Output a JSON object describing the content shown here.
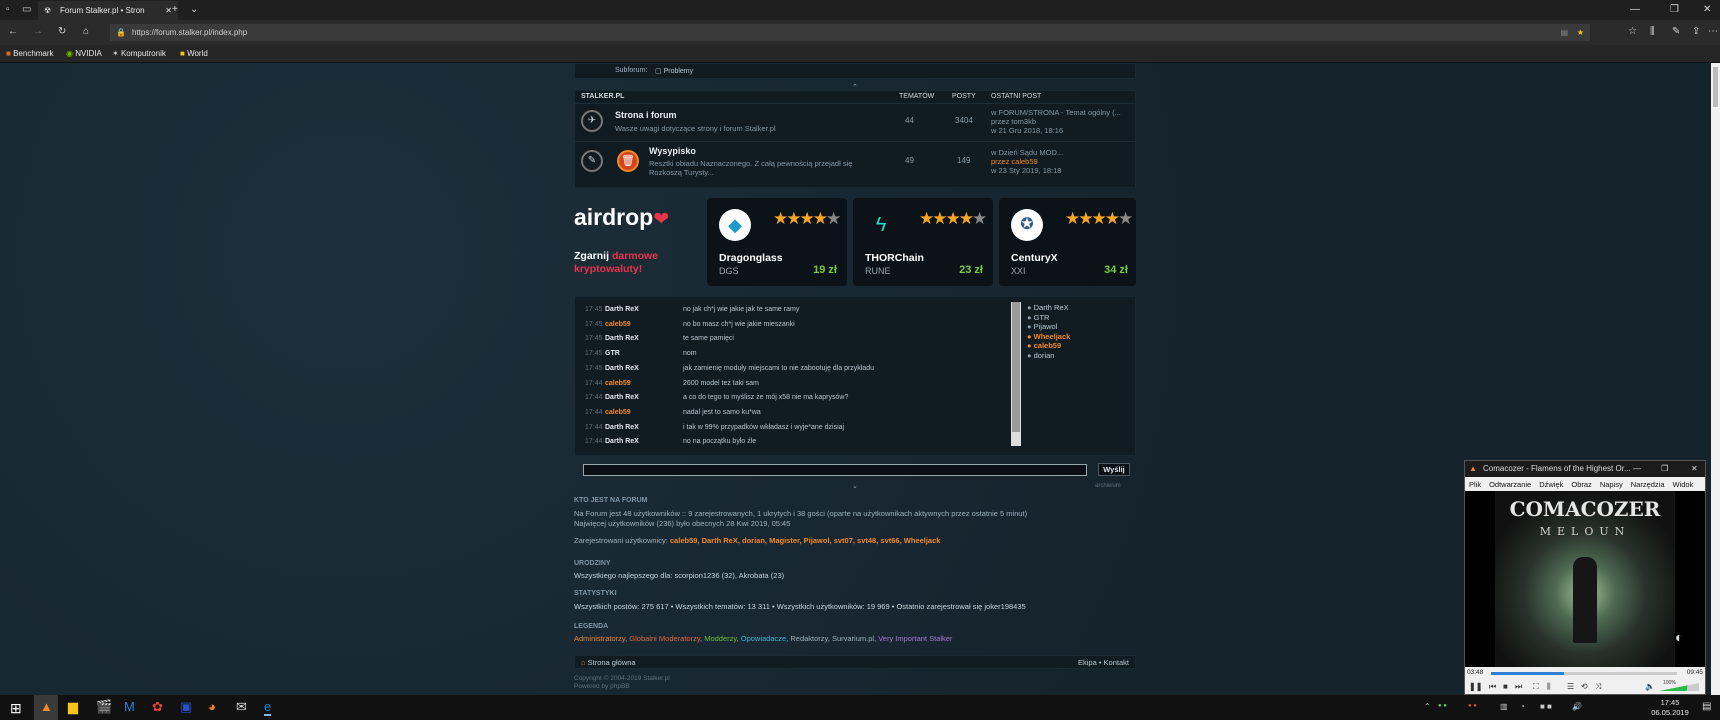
{
  "browser": {
    "tab_title": "Forum Stalker.pl • Stron",
    "url": "https://forum.stalker.pl/index.php",
    "bookmarks": [
      "Benchmark",
      "NVIDIA",
      "Komputronik",
      "World"
    ]
  },
  "forum": {
    "top_small": "Subforum:",
    "top_link": "Problemy",
    "section": "STALKER.PL",
    "col_topics": "TEMATÓW",
    "col_posts": "POSTY",
    "col_last": "OSTATNI POST",
    "rows": [
      {
        "title": "Strona i forum",
        "desc": "Wasze uwagi dotyczące strony i forum Stalker.pl",
        "topics": "44",
        "posts": "3404",
        "last1": "w FORUM/STRONA - Temat ogólny (...",
        "last2": "przez tom3kb",
        "last3": "w 21 Gru 2018, 18:16"
      },
      {
        "title": "Wysypisko",
        "desc": "Resztki obiadu Naznaczonego. Z całą pewnością przejadł się Rozkoszą Turysty...",
        "topics": "49",
        "posts": "149",
        "last1": "w Dzień Sądu MOD...",
        "last2": "przez caleb59",
        "last3": "w 23 Sty 2019, 18:18"
      }
    ]
  },
  "airdrop": {
    "logo": "airdrop",
    "line1": "Zgarnij",
    "line1b": "darmowe",
    "line2": "kryptowaluty!",
    "coins": [
      {
        "name": "Dragonglass",
        "ticker": "DGS",
        "value": "19 zł",
        "stars": 4
      },
      {
        "name": "THORChain",
        "ticker": "RUNE",
        "value": "23 zł",
        "stars": 4
      },
      {
        "name": "CenturyX",
        "ticker": "XXI",
        "value": "34 zł",
        "stars": 4
      }
    ]
  },
  "chat": {
    "messages": [
      {
        "time": "17:45",
        "user": "Darth ReX",
        "text": "no jak ch*j wie jakie jak te same ramy",
        "color": "white"
      },
      {
        "time": "17:45",
        "user": "caleb59",
        "text": "no bo masz ch*j wie jakie mieszanki",
        "color": "orange"
      },
      {
        "time": "17:45",
        "user": "Darth ReX",
        "text": "te same pamięci",
        "color": "white"
      },
      {
        "time": "17:45",
        "user": "GTR",
        "text": "nom",
        "color": "white"
      },
      {
        "time": "17:45",
        "user": "Darth ReX",
        "text": "jak zamienię moduły miejscami to nie zabootuję dla przykładu",
        "color": "white"
      },
      {
        "time": "17:44",
        "user": "caleb59",
        "text": "2600 model też taki sam",
        "color": "orange"
      },
      {
        "time": "17:44",
        "user": "Darth ReX",
        "text": "a co do tego to myślisz że mój x58 nie ma kaprysów?",
        "color": "white"
      },
      {
        "time": "17:44",
        "user": "caleb59",
        "text": "nadal jest to samo ku*wa",
        "color": "orange"
      },
      {
        "time": "17:44",
        "user": "Darth ReX",
        "text": "i tak w 99% przypadków wkładasz i wyje*ane dzisiaj",
        "color": "white"
      },
      {
        "time": "17:44",
        "user": "Darth ReX",
        "text": "no na początku było źle",
        "color": "white"
      }
    ],
    "online": [
      {
        "name": "Darth ReX",
        "color": "white"
      },
      {
        "name": "GTR",
        "color": "white"
      },
      {
        "name": "Pijawol",
        "color": "white"
      },
      {
        "name": "Wheeljack",
        "color": "orange"
      },
      {
        "name": "caleb59",
        "color": "orange"
      },
      {
        "name": "dorian",
        "color": "white"
      }
    ],
    "send_label": "Wyślij",
    "archive": "archiwum"
  },
  "who": {
    "heading": "KTO JEST NA FORUM",
    "line1": "Na Forum jest 48 użytkowników :: 9 zarejestrowanych, 1 ukrytych i 38 gości (oparte na użytkownikach aktywnych przez ostatnie 5 minut)",
    "line2": "Najwięcej użytkowników (236) było obecnych 28 Kwi 2019, 05:45",
    "reg_label": "Zarejestrowani użytkownicy:",
    "reg_users": "caleb59, Darth ReX, dorian, Magister, Pijawol, svt07, svt48, svt66, Wheeljack",
    "bday_heading": "URODZINY",
    "bday": "Wszystkiego najlepszego dla: scorpion1236 (32), Akrobata (23)",
    "stats_heading": "STATYSTYKI",
    "stats": "Wszystkich postów: 275 617 • Wszystkich tematów: 13 311 • Wszystkich użytkowników: 19 969 • Ostatnio zarejestrował się joker198435",
    "legend_heading": "LEGENDA",
    "legend": [
      "Administratorzy",
      "Globalni Moderatorzy",
      "Modderzy",
      "Opowiadacze",
      "Redaktorzy",
      "Survarium.pl",
      "Very Important Stalker"
    ]
  },
  "footer": {
    "home": "Strona główna",
    "right": "Ekipa • Kontakt",
    "copy": "Copyright © 2004-2019 Stalker.pl",
    "powered": "Powered by phpBB"
  },
  "vlc": {
    "title": "Comacozer - Flamens of the Highest Or...",
    "menu": [
      "Plik",
      "Odtwarzanie",
      "Dźwięk",
      "Obraz",
      "Napisy",
      "Narzędzia",
      "Widok"
    ],
    "time_elapsed": "03:48",
    "time_total": "09:45",
    "progress": 0.39,
    "volume": "100%"
  },
  "taskbar": {
    "clock_time": "17:45",
    "clock_date": "06.05.2019"
  }
}
